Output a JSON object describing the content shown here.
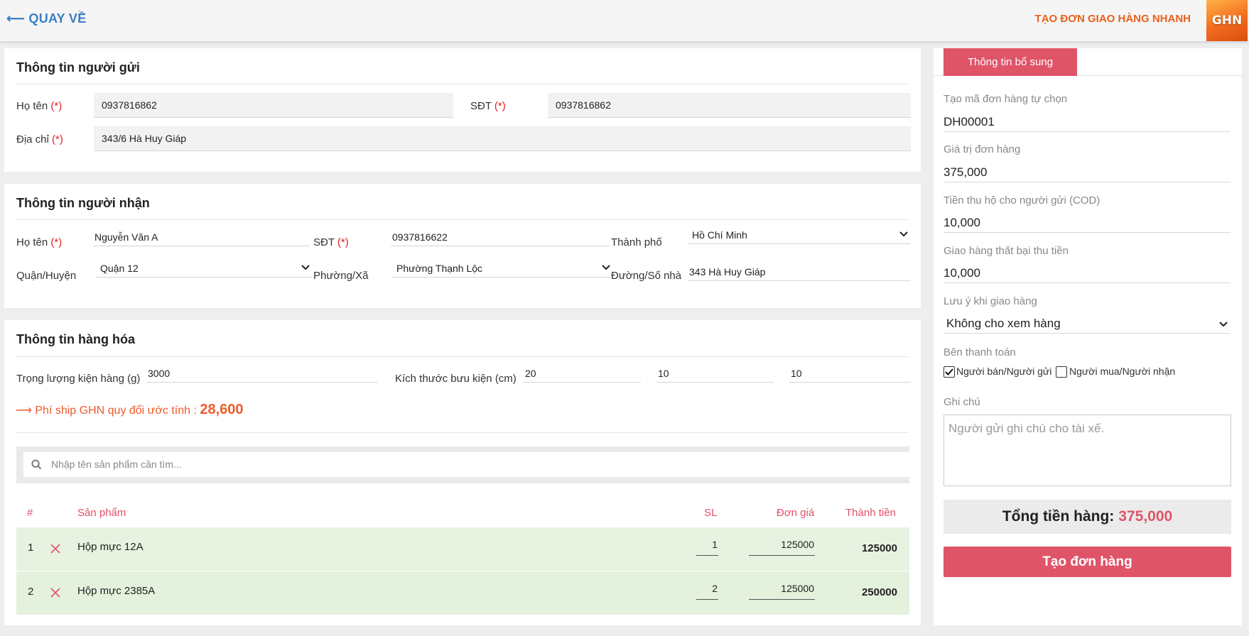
{
  "header": {
    "back_label": "⟵ QUAY VỀ",
    "brand_title": "TẠO ĐƠN GIAO HÀNG NHANH",
    "logo_text": "GHN"
  },
  "sender": {
    "title": "Thông tin người gửi",
    "name_label": "Họ tên",
    "name_value": "0937816862",
    "phone_label": "SĐT",
    "phone_value": "0937816862",
    "address_label": "Địa chỉ",
    "address_value": "343/6 Hà Huy Giáp",
    "required_mark": "(*)"
  },
  "receiver": {
    "title": "Thông tin người nhận",
    "name_label": "Họ tên",
    "name_value": "Nguyễn Văn A",
    "phone_label": "SĐT",
    "phone_value": "0937816622",
    "city_label": "Thành phố",
    "city_value": "Hồ Chí Minh",
    "district_label": "Quận/Huyện",
    "district_value": "Quận 12",
    "ward_label": "Phường/Xã",
    "ward_value": "Phường Thạnh Lộc",
    "street_label": "Đường/Số nhà",
    "street_value": "343 Hà Huy Giáp",
    "required_mark": "(*)"
  },
  "goods": {
    "title": "Thông tin hàng hóa",
    "weight_label": "Trọng lượng kiện hàng (g)",
    "weight_value": "3000",
    "size_label": "Kích thước bưu kiện (cm)",
    "length_value": "20",
    "width_value": "10",
    "height_value": "10",
    "ship_label": "⟶ Phí ship GHN quy đổi ước tính :",
    "ship_value": "28,600",
    "search_placeholder": "Nhập tên sản phẩm cần tìm...",
    "table": {
      "headers": {
        "index": "#",
        "product": "Sản phẩm",
        "qty": "SL",
        "price": "Đơn giá",
        "total": "Thành tiền"
      },
      "rows": [
        {
          "index": "1",
          "product": "Hộp mực 12A",
          "qty": "1",
          "price": "125000",
          "total": "125000"
        },
        {
          "index": "2",
          "product": "Hộp mực 2385A",
          "qty": "2",
          "price": "125000",
          "total": "250000"
        }
      ]
    }
  },
  "side": {
    "tab_label": "Thông tin bổ sung",
    "order_code_label": "Tạo mã đơn hàng tự chọn",
    "order_code_value": "DH00001",
    "order_value_label": "Giá trị đơn hàng",
    "order_value_value": "375,000",
    "cod_label": "Tiền thu hộ cho người gửi (COD)",
    "cod_value": "10,000",
    "fail_label": "Giao hàng thất bại thu tiền",
    "fail_value": "10,000",
    "note_delivery_label": "Lưu ý khi giao hàng",
    "note_delivery_value": "Không cho xem hàng",
    "payer_label": "Bên thanh toán",
    "payer_seller_label": "Người bán/Người gửi",
    "payer_seller_checked": true,
    "payer_buyer_label": "Người mua/Người nhận",
    "payer_buyer_checked": false,
    "remark_label": "Ghi chú",
    "remark_placeholder": "Người gửi ghi chú cho tài xế.",
    "total_label": "Tổng tiền hàng:",
    "total_value": "375,000",
    "create_label": "Tạo đơn hàng"
  },
  "colors": {
    "accent": "#e05468",
    "brand": "#e8601c",
    "link": "#3b7fc4",
    "row_bg": "#e7f3e0"
  }
}
